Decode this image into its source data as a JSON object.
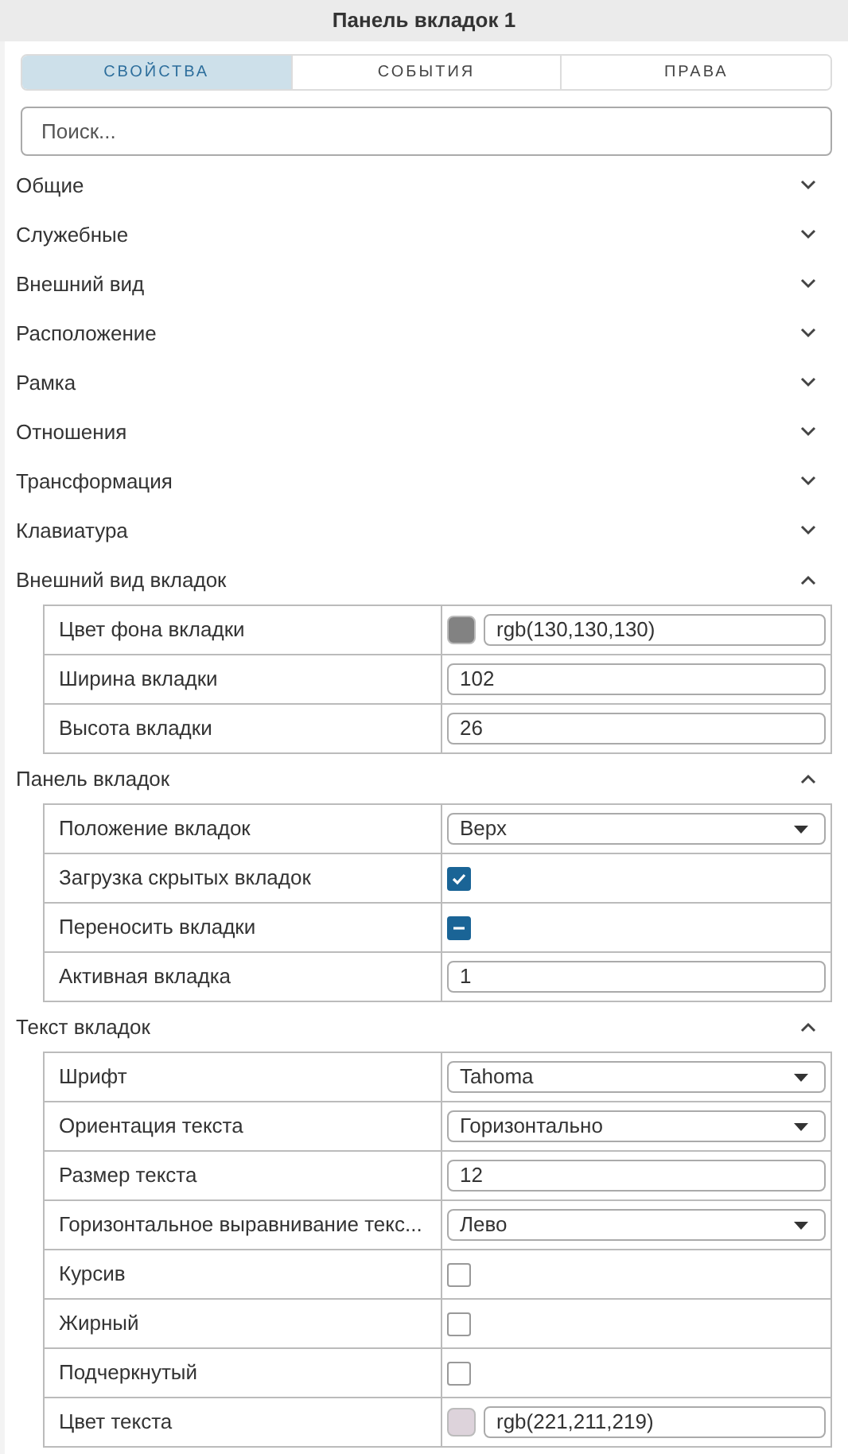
{
  "panel": {
    "title": "Панель вкладок 1"
  },
  "tabs": [
    {
      "label": "СВОЙСТВА",
      "selected": true
    },
    {
      "label": "СОБЫТИЯ",
      "selected": false
    },
    {
      "label": "ПРАВА",
      "selected": false
    }
  ],
  "search": {
    "placeholder": "Поиск..."
  },
  "sections": [
    {
      "title": "Общие",
      "expanded": false
    },
    {
      "title": "Служебные",
      "expanded": false
    },
    {
      "title": "Внешний вид",
      "expanded": false
    },
    {
      "title": "Расположение",
      "expanded": false
    },
    {
      "title": "Рамка",
      "expanded": false
    },
    {
      "title": "Отношения",
      "expanded": false
    },
    {
      "title": "Трансформация",
      "expanded": false
    },
    {
      "title": "Клавиатура",
      "expanded": false
    },
    {
      "title": "Внешний вид вкладок",
      "expanded": true,
      "rows": [
        {
          "kind": "color",
          "label": "Цвет фона вкладки",
          "color": "#828282",
          "value": "rgb(130,130,130)"
        },
        {
          "kind": "text",
          "label": "Ширина вкладки",
          "value": "102"
        },
        {
          "kind": "text",
          "label": "Высота вкладки",
          "value": "26"
        }
      ]
    },
    {
      "title": "Панель вкладок",
      "expanded": true,
      "rows": [
        {
          "kind": "select",
          "label": "Положение вкладок",
          "value": "Верх"
        },
        {
          "kind": "checkbox",
          "label": "Загрузка скрытых вкладок",
          "checked": true
        },
        {
          "kind": "mixed-checkbox",
          "label": "Переносить вкладки",
          "checked": true
        },
        {
          "kind": "text",
          "label": "Активная вкладка",
          "value": "1"
        }
      ]
    },
    {
      "title": "Текст вкладок",
      "expanded": true,
      "rows": [
        {
          "kind": "select",
          "label": "Шрифт",
          "value": "Tahoma"
        },
        {
          "kind": "select",
          "label": "Ориентация текста",
          "value": "Горизонтально"
        },
        {
          "kind": "text",
          "label": "Размер текста",
          "value": "12"
        },
        {
          "kind": "select",
          "label": "Горизонтальное выравнивание текс...",
          "value": "Лево"
        },
        {
          "kind": "checkbox",
          "label": "Курсив",
          "checked": false
        },
        {
          "kind": "checkbox",
          "label": "Жирный",
          "checked": false
        },
        {
          "kind": "checkbox",
          "label": "Подчеркнутый",
          "checked": false
        },
        {
          "kind": "color",
          "label": "Цвет текста",
          "color": "#ddd3db",
          "value": "rgb(221,211,219)"
        }
      ]
    }
  ]
}
